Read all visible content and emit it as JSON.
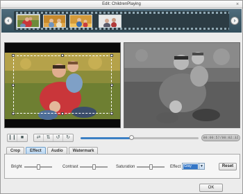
{
  "window": {
    "title": "Edit: ChildrenPlaying",
    "close_glyph": "×"
  },
  "filmstrip": {
    "prev_glyph": "‹",
    "next_glyph": "›",
    "thumbnails": [
      {
        "name": "thumbnail-1",
        "selected": true
      },
      {
        "name": "thumbnail-2",
        "selected": false
      },
      {
        "name": "thumbnail-3",
        "selected": false
      },
      {
        "name": "thumbnail-4",
        "selected": false
      }
    ]
  },
  "preview": {
    "original_label": "",
    "output_effect": "Gray"
  },
  "playback": {
    "buttons": [
      {
        "name": "pause-icon",
        "glyph": "❙❙"
      },
      {
        "name": "stop-icon",
        "glyph": "■"
      }
    ],
    "edit_buttons": [
      {
        "name": "flip-horizontal-icon",
        "glyph": "⇄"
      },
      {
        "name": "flip-vertical-icon",
        "glyph": "⇅"
      },
      {
        "name": "rotate-left-icon",
        "glyph": "↺"
      },
      {
        "name": "rotate-right-icon",
        "glyph": "↻"
      }
    ],
    "progress": 0.43,
    "timecode": "00:00:57/00:02:32"
  },
  "tabs": [
    {
      "label": "Crop",
      "active": false
    },
    {
      "label": "Effect",
      "active": true
    },
    {
      "label": "Audio",
      "active": false
    },
    {
      "label": "Watermark",
      "active": false
    }
  ],
  "effect_panel": {
    "bright_label": "Bright",
    "contrast_label": "Contrast",
    "saturation_label": "Saturation",
    "effect_label": "Effect",
    "effect_value": "Gray",
    "bright_level": 0.5,
    "contrast_level": 0.5,
    "saturation_level": 0.5,
    "reset_label": "Reset"
  },
  "footer": {
    "ok_label": "OK"
  },
  "colors": {
    "filmstrip": "#3d5866",
    "accent": "#3a7fc4",
    "active_tab": "#b4d3f1"
  }
}
